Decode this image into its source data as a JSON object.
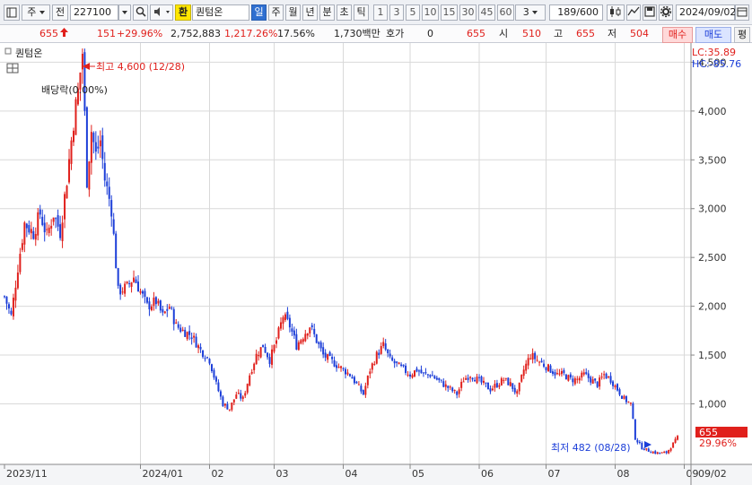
{
  "toolbar": {
    "type_label": "주",
    "jeon_label": "전",
    "code": "227100",
    "exchange_badge": "환",
    "stock_name": "퀀텀온",
    "periods": [
      "일",
      "주",
      "월",
      "년",
      "분",
      "초",
      "틱"
    ],
    "active_period": "일",
    "intervals": [
      "1",
      "3",
      "5",
      "10",
      "15",
      "30",
      "45",
      "60"
    ],
    "interval_select": "3",
    "count": "189",
    "count_max": "/600",
    "date": "2024/09/02"
  },
  "quote": {
    "price": "655",
    "change": "151",
    "change_pct": "+29.96%",
    "volume": "2,752,883",
    "volume_pct": "1,217.26%",
    "turnover_pct": "17.56%",
    "amount": "1,730백만",
    "hoga_label": "호가",
    "hoga_value": "0",
    "hoga_price": "655",
    "open_label": "시",
    "open_value": "510",
    "high_label": "고",
    "high_value": "655",
    "low_label": "저",
    "low_value": "504",
    "buy_label": "매수",
    "sell_label": "매도",
    "eval_label": "평"
  },
  "chart_data": {
    "type": "candlestick",
    "title": "퀀텀온",
    "ylim": [
      380,
      4660
    ],
    "y_ticks": [
      1000,
      1500,
      2000,
      2500,
      3000,
      3500,
      4000,
      4500
    ],
    "y_tick_labels": [
      "1,000",
      "1,500",
      "2,000",
      "2,500",
      "3,000",
      "3,500",
      "4,000",
      "4,500"
    ],
    "x_tick_labels": [
      "2023/11",
      "2024/01",
      "02",
      "03",
      "04",
      "05",
      "06",
      "07",
      "08",
      "09",
      "09/02"
    ],
    "x_tick_days": [
      0,
      61,
      92,
      121,
      152,
      182,
      213,
      243,
      274,
      305
    ],
    "x_range_days": [
      0,
      306
    ],
    "lc_label": "LC:35.89",
    "hc_label": "HC:-85.76",
    "high_annotation": "최고 4,600 (12/28)",
    "low_annotation": "최저 482 (08/28)",
    "dividend_annotation": "배당락(0.00%)",
    "last_price_label": "655",
    "last_pct_label": "29.96%",
    "up_color": "#e0201c",
    "down_color": "#1c3ed8",
    "anchors": [
      [
        0,
        2100
      ],
      [
        3,
        1900
      ],
      [
        6,
        2400
      ],
      [
        9,
        2850
      ],
      [
        13,
        2750
      ],
      [
        16,
        2950
      ],
      [
        19,
        2720
      ],
      [
        22,
        2950
      ],
      [
        25,
        2760
      ],
      [
        28,
        3300
      ],
      [
        31,
        3900
      ],
      [
        33,
        4200
      ],
      [
        35,
        4600
      ],
      [
        37,
        3300
      ],
      [
        39,
        3800
      ],
      [
        41,
        3550
      ],
      [
        43,
        3700
      ],
      [
        45,
        3300
      ],
      [
        48,
        3000
      ],
      [
        51,
        2150
      ],
      [
        55,
        2200
      ],
      [
        58,
        2300
      ],
      [
        61,
        2150
      ],
      [
        64,
        2000
      ],
      [
        68,
        2050
      ],
      [
        71,
        1900
      ],
      [
        74,
        2000
      ],
      [
        77,
        1800
      ],
      [
        80,
        1750
      ],
      [
        84,
        1700
      ],
      [
        88,
        1550
      ],
      [
        92,
        1450
      ],
      [
        95,
        1200
      ],
      [
        98,
        1000
      ],
      [
        101,
        950
      ],
      [
        104,
        1100
      ],
      [
        107,
        1050
      ],
      [
        110,
        1300
      ],
      [
        113,
        1500
      ],
      [
        116,
        1600
      ],
      [
        119,
        1450
      ],
      [
        122,
        1650
      ],
      [
        125,
        1900
      ],
      [
        128,
        1800
      ],
      [
        131,
        1600
      ],
      [
        134,
        1700
      ],
      [
        137,
        1800
      ],
      [
        140,
        1650
      ],
      [
        143,
        1500
      ],
      [
        146,
        1450
      ],
      [
        149,
        1400
      ],
      [
        152,
        1350
      ],
      [
        155,
        1300
      ],
      [
        158,
        1200
      ],
      [
        161,
        1100
      ],
      [
        164,
        1350
      ],
      [
        167,
        1500
      ],
      [
        170,
        1600
      ],
      [
        173,
        1450
      ],
      [
        176,
        1400
      ],
      [
        179,
        1350
      ],
      [
        182,
        1300
      ],
      [
        185,
        1350
      ],
      [
        188,
        1300
      ],
      [
        191,
        1300
      ],
      [
        194,
        1250
      ],
      [
        197,
        1200
      ],
      [
        200,
        1150
      ],
      [
        203,
        1100
      ],
      [
        206,
        1250
      ],
      [
        209,
        1300
      ],
      [
        212,
        1250
      ],
      [
        215,
        1200
      ],
      [
        218,
        1150
      ],
      [
        221,
        1200
      ],
      [
        224,
        1250
      ],
      [
        227,
        1200
      ],
      [
        230,
        1100
      ],
      [
        233,
        1350
      ],
      [
        236,
        1500
      ],
      [
        239,
        1450
      ],
      [
        242,
        1400
      ],
      [
        245,
        1350
      ],
      [
        248,
        1300
      ],
      [
        251,
        1300
      ],
      [
        254,
        1250
      ],
      [
        257,
        1250
      ],
      [
        260,
        1300
      ],
      [
        263,
        1250
      ],
      [
        266,
        1200
      ],
      [
        269,
        1300
      ],
      [
        272,
        1250
      ],
      [
        275,
        1150
      ],
      [
        278,
        1050
      ],
      [
        281,
        1000
      ],
      [
        283,
        650
      ],
      [
        286,
        550
      ],
      [
        289,
        520
      ],
      [
        292,
        500
      ],
      [
        294,
        495
      ],
      [
        297,
        500
      ],
      [
        299,
        560
      ],
      [
        302,
        655
      ]
    ]
  }
}
